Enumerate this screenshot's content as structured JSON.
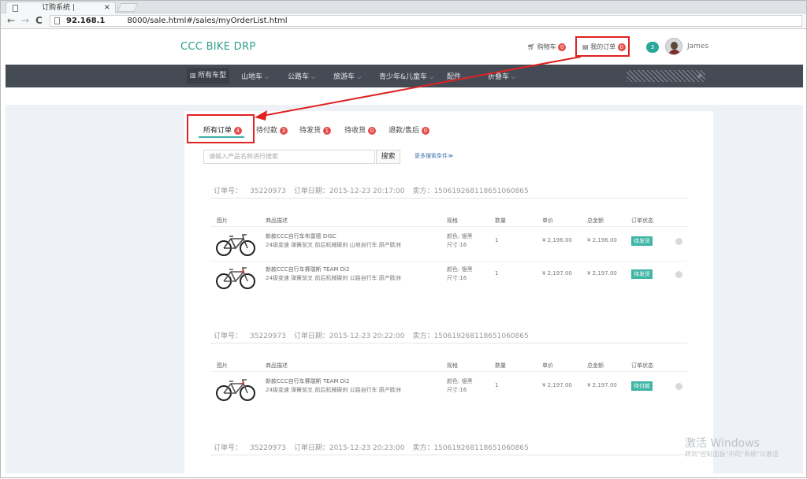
{
  "browser": {
    "tab_title": "订购系统 |",
    "tab_close": "×",
    "url_host": "92.168.1",
    "url_rest": "8000/sale.html#/sales/myOrderList.html"
  },
  "header": {
    "logo": "CCC BIKE DRP",
    "cart_label": "购物车",
    "cart_count": "0",
    "my_orders_label": "我的订单",
    "my_orders_count": "0",
    "message_count": "3",
    "username": "James"
  },
  "category_nav": [
    {
      "label": "所有车型",
      "active": true
    },
    {
      "label": "山地车"
    },
    {
      "label": "公路车"
    },
    {
      "label": "旅游车"
    },
    {
      "label": "青少年&儿童车"
    },
    {
      "label": "配件"
    },
    {
      "label": "折叠车"
    }
  ],
  "status_tabs": [
    {
      "label": "所有订单",
      "count": "4"
    },
    {
      "label": "待付款",
      "count": "3"
    },
    {
      "label": "待发货",
      "count": "1"
    },
    {
      "label": "待收货",
      "count": "0"
    },
    {
      "label": "退款/售后",
      "count": "0"
    }
  ],
  "search": {
    "placeholder": "请输入产品名称进行搜索",
    "button": "搜索",
    "more": "更多搜索条件≫"
  },
  "columns": {
    "image": "图片",
    "desc": "商品描述",
    "spec": "规格",
    "qty": "数量",
    "price": "单价",
    "total": "总金额",
    "status": "订单状态"
  },
  "orders": [
    {
      "no_label": "订单号：",
      "no": "35220973",
      "date_label": "订单日期：",
      "date": "2015-12-23 20:17:00",
      "seller_label": "卖方：",
      "seller": "150619268118651060865",
      "items": [
        {
          "desc1": "新款CCC自行车布雷德 DISC",
          "desc2": "24级变速 弹簧前叉 前后机械碟刹 山地自行车 原产欧洲",
          "spec1": "颜色: 银黑",
          "spec2": "尺寸:16",
          "qty": "1",
          "price": "¥ 2,196.00",
          "total": "¥ 2,196.00",
          "status": "待发货"
        },
        {
          "desc1": "新款CCC自行车赛瑞斯 TEAM Di2",
          "desc2": "24级变速 弹簧前叉 前后机械碟刹 公路自行车 原产欧洲",
          "spec1": "颜色: 银黑",
          "spec2": "尺寸:16",
          "qty": "1",
          "price": "¥ 2,197.00",
          "total": "¥ 2,197.00",
          "status": "待发货"
        }
      ]
    },
    {
      "no_label": "订单号：",
      "no": "35220973",
      "date_label": "订单日期：",
      "date": "2015-12-23 20:22:00",
      "seller_label": "卖方：",
      "seller": "150619268118651060865",
      "items": [
        {
          "desc1": "新款CCC自行车赛瑞斯 TEAM Di2",
          "desc2": "24级变速 弹簧前叉 前后机械碟刹 公路自行车 原产欧洲",
          "spec1": "颜色: 银黑",
          "spec2": "尺寸:16",
          "qty": "1",
          "price": "¥ 2,197.00",
          "total": "¥ 2,197.00",
          "status": "待付款"
        }
      ]
    },
    {
      "no_label": "订单号：",
      "no": "35220973",
      "date_label": "订单日期：",
      "date": "2015-12-23 20:23:00",
      "seller_label": "卖方：",
      "seller": "150619268118651060865",
      "items": []
    }
  ],
  "watermark": {
    "line1": "激活 Windows",
    "line2": "转到\"控制面板\"中的\"系统\"以激活"
  },
  "colors": {
    "accent": "#3db2a4",
    "highlight": "#e02222",
    "nav_bg": "#454b55",
    "badge": "#e54b4b"
  }
}
